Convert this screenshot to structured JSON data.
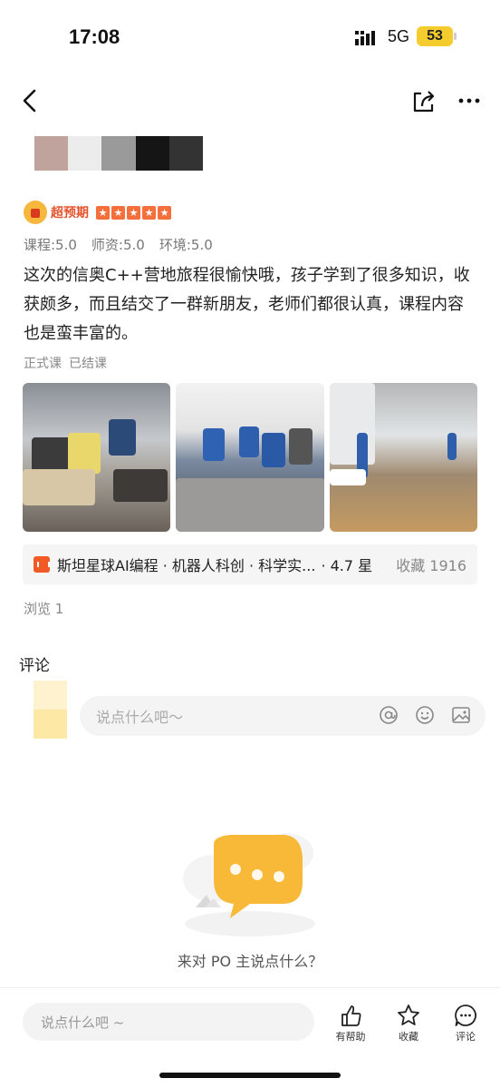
{
  "status_bar": {
    "time": "17:08",
    "network": "5G",
    "battery": "53"
  },
  "review": {
    "badge": "超预期",
    "scores": [
      "课程:5.0",
      "师资:5.0",
      "环境:5.0"
    ],
    "text": "这次的信奥C++营地旅程很愉快哦，孩子学到了很多知识，收获颇多，而且结交了一群新朋友，老师们都很认真，课程内容也是蛮丰富的。",
    "tags": [
      "正式课",
      "已结课"
    ]
  },
  "shop": {
    "name": "斯坦星球AI编程 · 机器人科创 · 科学实...",
    "rating": "· 4.7 星",
    "favorites": "收藏 1916"
  },
  "views": "浏览 1",
  "comments": {
    "title": "评论",
    "input_placeholder": "说点什么吧～",
    "empty_text": "来对 PO 主说点什么？"
  },
  "bottom_bar": {
    "input_placeholder": "说点什么吧 ~",
    "helpful_label": "有帮助",
    "favorite_label": "收藏",
    "comment_label": "评论"
  },
  "colors": {
    "accent": "#f36f3c",
    "badge_text": "#e5542d",
    "battery": "#f5cc2e",
    "empty_bubble": "#f8b838"
  },
  "icons": [
    "signal-icon",
    "back-icon",
    "share-icon",
    "more-icon",
    "crown-icon",
    "star-icon",
    "shop-icon",
    "at-icon",
    "emoji-icon",
    "image-icon",
    "chat-bubble-icon",
    "thumbs-up-icon",
    "star-outline-icon",
    "comment-icon"
  ]
}
